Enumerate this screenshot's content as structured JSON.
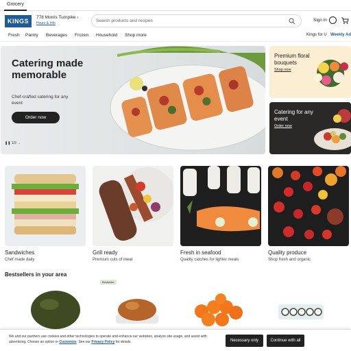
{
  "tab": {
    "label": "Grocery"
  },
  "header": {
    "logo": "KINGS",
    "store_address": "778 Morris Turnpike",
    "hours_link": "Hours & Info",
    "search_placeholder": "Search products and recipes",
    "signin": "Sign in"
  },
  "nav": {
    "items": [
      "Fresh",
      "Pantry",
      "Beverages",
      "Frozen",
      "Household",
      "Shop more"
    ],
    "kings_for_u": "Kings for U",
    "weekly_ad": "Weekly Ad"
  },
  "hero": {
    "title": "Catering made memorable",
    "subtitle": "Chef-crafted catering for any event",
    "button": "Order now",
    "slide_counter": "1/3"
  },
  "side_promos": [
    {
      "title": "Premium floral bouquets",
      "link": "Shop now"
    },
    {
      "title": "Catering for any event",
      "link": "Order now"
    }
  ],
  "categories": [
    {
      "title": "Sandwiches",
      "subtitle": "Chef made daily"
    },
    {
      "title": "Grill ready",
      "subtitle": "Premium cuts of meat"
    },
    {
      "title": "Fresh in seafood",
      "subtitle": "Quality catches for lighter meals"
    },
    {
      "title": "Quality produce",
      "subtitle": "Shop fresh and organic"
    }
  ],
  "bestsellers": {
    "heading": "Bestsellers in your area",
    "badge": "Bestseller"
  },
  "cookie": {
    "text_before": "We and our partners use cookies and other technologies to operate and enhance our websites, analyze site usage, and assist with advertising. Choose an option or ",
    "customize": "Customize",
    "text_mid": ". See our ",
    "privacy": "Privacy Policy",
    "text_after": " for details.",
    "necessary_only": "Necessary only",
    "continue_all": "Continue with all"
  },
  "colors": {
    "brand": "#1f5b96",
    "dark_button": "#222222"
  }
}
